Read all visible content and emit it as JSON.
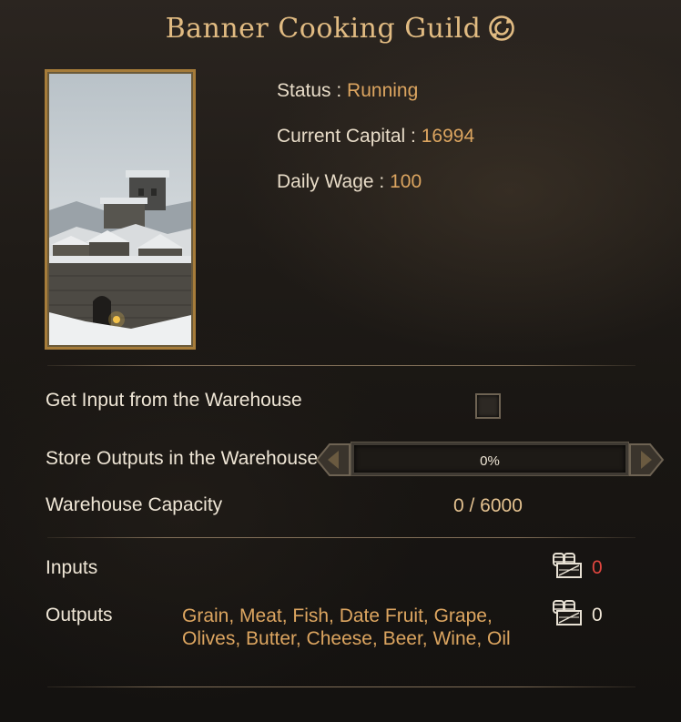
{
  "header": {
    "title": "Banner Cooking Guild",
    "rename_icon": "circular-arrows-icon"
  },
  "workshop_info": {
    "status_label": "Status :",
    "status_value": "Running",
    "capital_label": "Current Capital :",
    "capital_value": "16994",
    "wage_label": "Daily Wage :",
    "wage_value": "100",
    "image": "snowy-castle-town"
  },
  "warehouse": {
    "input_label": "Get Input from the Warehouse",
    "input_checked": false,
    "store_label": "Store Outputs in the Warehouse",
    "store_percent_text": "0%",
    "store_fraction": 0,
    "capacity_label": "Warehouse Capacity",
    "capacity_value": "0 / 6000"
  },
  "production": {
    "inputs_label": "Inputs",
    "inputs_items": "",
    "inputs_count": "0",
    "inputs_count_color": "#e0463f",
    "outputs_label": "Outputs",
    "outputs_items": "Grain, Meat, Fish, Date Fruit, Grape, Olives, Butter, Cheese, Beer, Wine, Oil",
    "outputs_count": "0",
    "outputs_count_color": "#efe6d6",
    "stock_icon": "barrels-crate-icon"
  },
  "colors": {
    "accent": "#e1bb82",
    "value": "#dca560",
    "frame": "#a67c3a"
  }
}
